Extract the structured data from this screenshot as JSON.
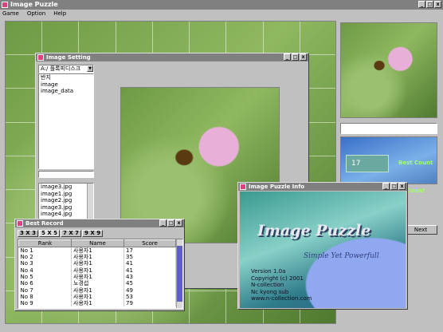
{
  "app": {
    "title": "Image Puzzle"
  },
  "menu": [
    "Game",
    "Option",
    "Help"
  ],
  "colors": {
    "titlebar_inactive": "#808080",
    "accent_pink": "#e04080"
  },
  "image_setting": {
    "title": "Image Setting",
    "drive_select": "A:/ 플록피디스크",
    "folders": [
      "반지",
      "image",
      "image_data"
    ],
    "files": [
      "image3.jpg",
      "image1.jpg",
      "image2.jpg",
      "image3.jpg",
      "image4.jpg"
    ]
  },
  "side_panel": {
    "count_value": "17",
    "best_count_label": "Best Count",
    "count_label": "Count",
    "next_label": "Next"
  },
  "best_record": {
    "title": "Best Record",
    "tabs": [
      "3 X 3",
      "5 X 5",
      "7 X 7",
      "9 X 9"
    ],
    "columns": [
      "Rank",
      "Name",
      "Score"
    ],
    "rows": [
      [
        "No 1",
        "사용자1",
        "17"
      ],
      [
        "No 2",
        "사용자1",
        "35"
      ],
      [
        "No 3",
        "사용자1",
        "41"
      ],
      [
        "No 4",
        "사용자1",
        "41"
      ],
      [
        "No 5",
        "사용자1",
        "43"
      ],
      [
        "No 6",
        "노경섭",
        "45"
      ],
      [
        "No 7",
        "사용자1",
        "49"
      ],
      [
        "No 8",
        "사용자1",
        "53"
      ],
      [
        "No 9",
        "사용자1",
        "79"
      ]
    ]
  },
  "info": {
    "title": "Image Puzzle Info",
    "logo_text": "Image Puzzle",
    "tagline": "Simple Yet Powerfull",
    "version": "Version 1.0a",
    "copyright": "Copyright (c) 2001",
    "company": "N-collection",
    "author": "Nc kyong sub",
    "website": "www.n-collection.com"
  }
}
